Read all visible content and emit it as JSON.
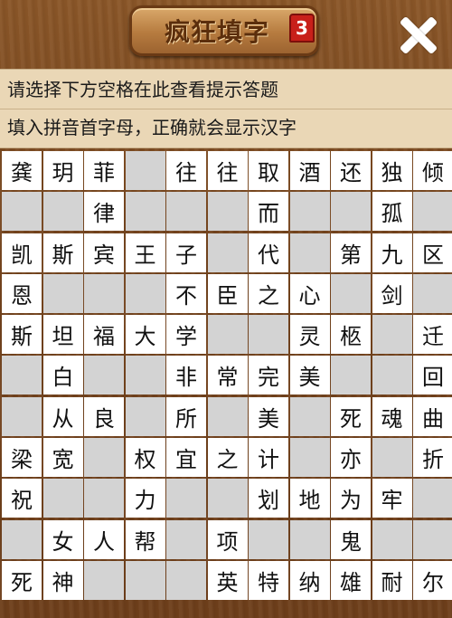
{
  "header": {
    "title": "疯狂填字",
    "level": "3",
    "close_icon": "close-icon"
  },
  "hint": {
    "line1": "请选择下方空格在此查看提示答题",
    "line2": "填入拼音首字母，正确就会显示汉字"
  },
  "colors": {
    "wood": "#7a4a22",
    "hint_bg": "#ead7b6",
    "cell_filled": "#ffffff",
    "cell_blank": "#d3d3d3",
    "badge": "#c8201a"
  },
  "grid": {
    "rows": [
      [
        "龚",
        "玥",
        "菲",
        "",
        "往",
        "往",
        "取",
        "酒",
        "还",
        "独",
        "倾"
      ],
      [
        "",
        "",
        "律",
        "",
        "",
        "",
        "而",
        "",
        "",
        "孤",
        ""
      ],
      [
        "凯",
        "斯",
        "宾",
        "王",
        "子",
        "",
        "代",
        "",
        "第",
        "九",
        "区"
      ],
      [
        "恩",
        "",
        "",
        "",
        "不",
        "臣",
        "之",
        "心",
        "",
        "剑",
        ""
      ],
      [
        "斯",
        "坦",
        "福",
        "大",
        "学",
        "",
        "",
        "灵",
        "柩",
        "",
        "迁"
      ],
      [
        "",
        "白",
        "",
        "",
        "非",
        "常",
        "完",
        "美",
        "",
        "",
        "回"
      ],
      [
        "",
        "从",
        "良",
        "",
        "所",
        "",
        "美",
        "",
        "死",
        "魂",
        "曲"
      ],
      [
        "梁",
        "宽",
        "",
        "权",
        "宜",
        "之",
        "计",
        "",
        "亦",
        "",
        "折"
      ],
      [
        "祝",
        "",
        "",
        "力",
        "",
        "",
        "划",
        "地",
        "为",
        "牢",
        ""
      ],
      [
        "",
        "女",
        "人",
        "帮",
        "",
        "项",
        "",
        "",
        "鬼",
        "",
        ""
      ],
      [
        "死",
        "神",
        "",
        "",
        "",
        "英",
        "特",
        "纳",
        "雄",
        "耐",
        "尔"
      ]
    ]
  }
}
